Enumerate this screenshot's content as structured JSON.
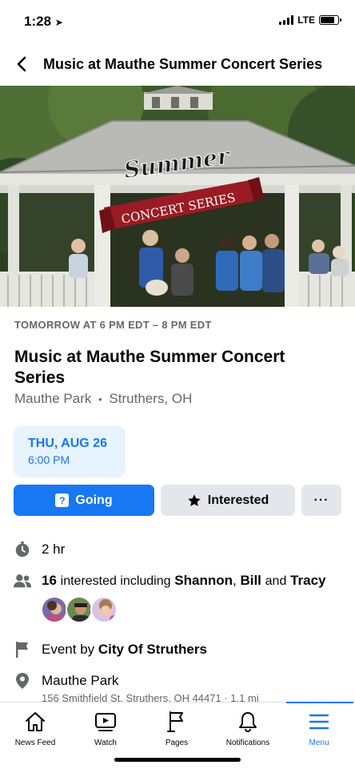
{
  "status_bar": {
    "time": "1:28",
    "network": "LTE"
  },
  "nav": {
    "title": "Music at Mauthe Summer Concert Series"
  },
  "cover": {
    "banner_line1": "Summer",
    "banner_line2": "CONCERT SERIES"
  },
  "event": {
    "time_range": "TOMORROW AT 6 PM EDT – 8 PM EDT",
    "title": "Music at Mauthe Summer Concert Series",
    "place": "Mauthe Park",
    "city": "Struthers, OH",
    "separator": "•"
  },
  "date_box": {
    "day": "THU, AUG 26",
    "time": "6:00 PM"
  },
  "actions": {
    "going_label": "Going",
    "interested_label": "Interested",
    "more_label": "···"
  },
  "details": {
    "duration": "2 hr",
    "interested_count": "16",
    "interested_text": "interested including",
    "names": [
      "Shannon",
      "Bill",
      "Tracy"
    ],
    "comma": ",",
    "and_text": "and",
    "event_by_prefix": "Event by",
    "host": "City Of Struthers",
    "venue_name": "Mauthe Park",
    "venue_address": "156 Smithfield St, Struthers, OH 44471 · 1.1 mi"
  },
  "tabs": [
    {
      "label": "News Feed"
    },
    {
      "label": "Watch"
    },
    {
      "label": "Pages"
    },
    {
      "label": "Notifications"
    },
    {
      "label": "Menu"
    }
  ],
  "colors": {
    "accent": "#1877f2",
    "secondary_text": "#65676b",
    "button_gray": "#e4e6eb",
    "date_box_bg": "#e7f3ff",
    "banner_red": "#b3202a"
  }
}
